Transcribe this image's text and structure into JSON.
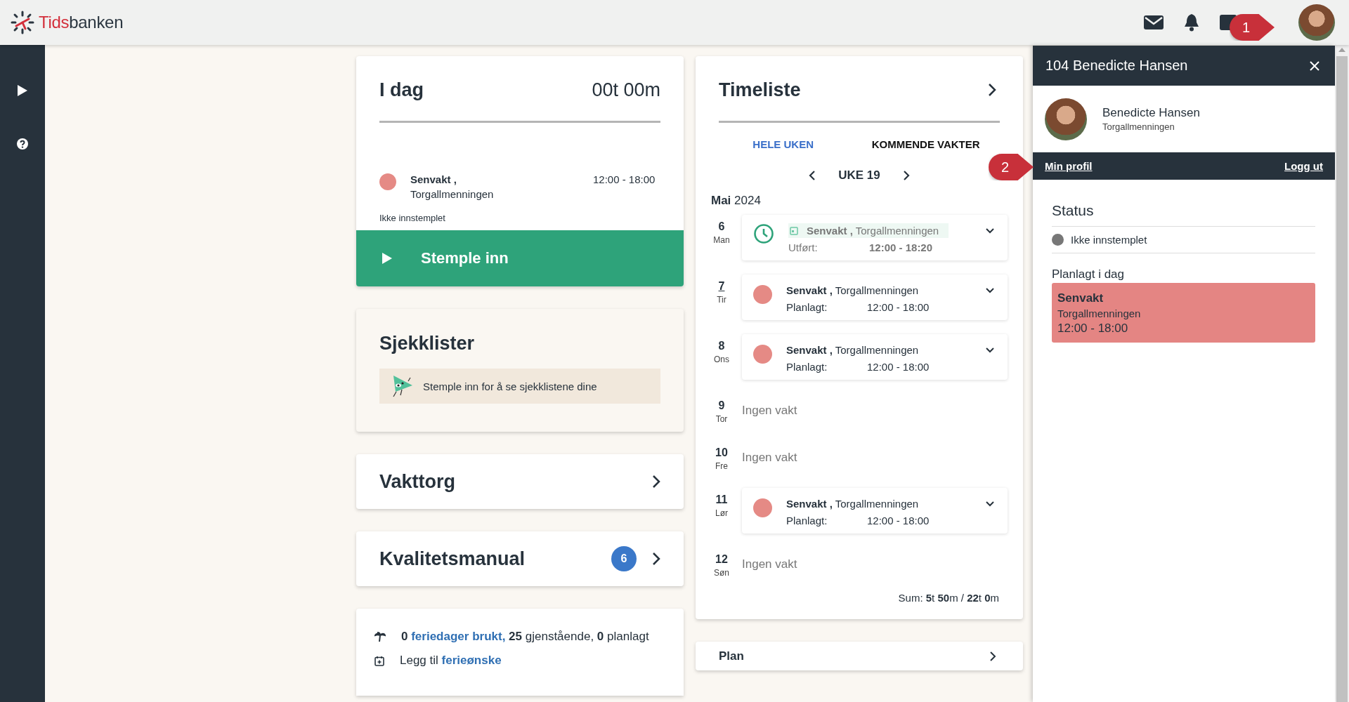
{
  "header": {
    "logo": {
      "part_1": "Tids",
      "part_2": "banken"
    }
  },
  "annotations": [
    {
      "label": "1"
    },
    {
      "label": "2"
    }
  ],
  "today": {
    "title": "I dag",
    "duration": "00t 00m",
    "shift": {
      "name": "Senvakt ,",
      "location": "Torgallmenningen",
      "time": "12:00 - 18:00"
    },
    "status": "Ikke innstemplet",
    "button": "Stemple inn"
  },
  "checklists": {
    "title": "Sjekklister",
    "message": "Stemple inn for å se sjekklistene dine"
  },
  "shift_market": {
    "title": "Vakttorg"
  },
  "quality_manual": {
    "title": "Kvalitetsmanual",
    "badge": "6"
  },
  "vacation": {
    "lines": [
      [
        {
          "kind": "bold",
          "text": "0"
        },
        {
          "kind": "link",
          "text": "feriedager brukt,"
        },
        {
          "kind": "bold",
          "text": "25"
        },
        {
          "kind": "plain",
          "text": "gjenstående,"
        },
        {
          "kind": "bold",
          "text": "0"
        },
        {
          "kind": "plain",
          "text": "planlagt"
        }
      ],
      [
        {
          "kind": "plain",
          "text": "Legg til"
        },
        {
          "kind": "link",
          "text": "ferieønske"
        }
      ]
    ]
  },
  "timesheet": {
    "title": "Timeliste",
    "tabs": [
      {
        "label": "HELE UKEN",
        "selected": true
      },
      {
        "label": "KOMMENDE VAKTER",
        "selected": false
      }
    ],
    "week": "UKE 19",
    "month": "Mai",
    "year": "2024",
    "days": [
      {
        "date": "6",
        "weekday": "Man",
        "today": false,
        "kind": "done",
        "shift": "Senvakt ,",
        "location": "Torgallmenningen",
        "label": "Utført:",
        "time": "12:00 - 18:20"
      },
      {
        "date": "7",
        "weekday": "Tir",
        "today": true,
        "kind": "planned",
        "shift": "Senvakt ,",
        "location": "Torgallmenningen",
        "label": "Planlagt:",
        "time": "12:00 - 18:00"
      },
      {
        "date": "8",
        "weekday": "Ons",
        "today": false,
        "kind": "planned",
        "shift": "Senvakt ,",
        "location": "Torgallmenningen",
        "label": "Planlagt:",
        "time": "12:00 - 18:00"
      },
      {
        "date": "9",
        "weekday": "Tor",
        "today": false,
        "kind": "empty",
        "text": "Ingen vakt"
      },
      {
        "date": "10",
        "weekday": "Fre",
        "today": false,
        "kind": "empty",
        "text": "Ingen vakt"
      },
      {
        "date": "11",
        "weekday": "Lør",
        "today": false,
        "kind": "planned",
        "shift": "Senvakt ,",
        "location": "Torgallmenningen",
        "label": "Planlagt:",
        "time": "12:00 - 18:00"
      },
      {
        "date": "12",
        "weekday": "Søn",
        "today": false,
        "kind": "empty",
        "text": "Ingen vakt"
      }
    ],
    "sum": "Sum: **5**t **50**m / **22**t **0**m"
  },
  "plan": {
    "title": "Plan"
  },
  "profile_panel": {
    "title": "104 Benedicte Hansen",
    "name": "Benedicte Hansen",
    "location": "Torgallmenningen",
    "links": [
      "Min profil",
      "Logg ut"
    ],
    "status_heading": "Status",
    "status": "Ikke innstemplet",
    "planned_heading": "Planlagt i dag",
    "planned_shift": {
      "name": "Senvakt",
      "location": "Torgallmenningen",
      "time": "12:00 - 18:00"
    }
  }
}
